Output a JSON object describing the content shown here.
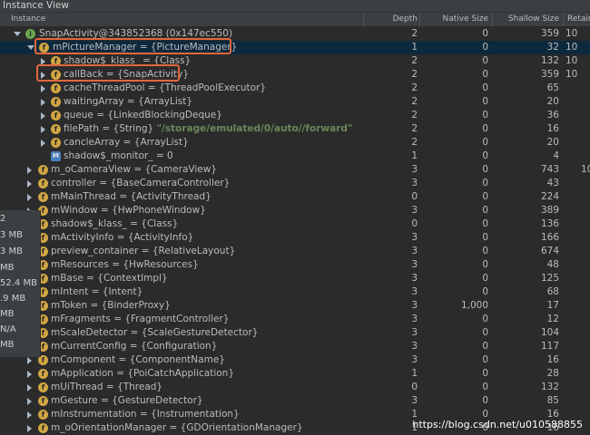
{
  "window": {
    "title": "Instance View"
  },
  "columns": {
    "instance": "Instance",
    "depth": "Depth",
    "native": "Native Size",
    "shallow": "Shallow Size",
    "retained": "Retaine"
  },
  "rows": [
    {
      "label": "SnapActivity@343852368 (0x147ec550)",
      "depth": "2",
      "native": "0",
      "shallow": "359",
      "retained": "10"
    },
    {
      "label": "mPictureManager = {PictureManager}",
      "depth": "1",
      "native": "0",
      "shallow": "32",
      "retained": "10"
    },
    {
      "label": "shadow$_klass_ = {Class}",
      "depth": "2",
      "native": "0",
      "shallow": "132",
      "retained": "10"
    },
    {
      "label": "callBack = {SnapActivity}",
      "depth": "2",
      "native": "0",
      "shallow": "359",
      "retained": "10"
    },
    {
      "label": "cacheThreadPool = {ThreadPoolExecutor}",
      "depth": "2",
      "native": "0",
      "shallow": "65",
      "retained": ""
    },
    {
      "label": "waitingArray = {ArrayList}",
      "depth": "2",
      "native": "0",
      "shallow": "20",
      "retained": ""
    },
    {
      "label": "queue = {LinkedBlockingDeque}",
      "depth": "2",
      "native": "0",
      "shallow": "36",
      "retained": ""
    },
    {
      "label": "filePath = {String} ",
      "str": "\"/storage/emulated/0/auto//forward\"",
      "depth": "2",
      "native": "0",
      "shallow": "16",
      "retained": ""
    },
    {
      "label": "cancleArray = {ArrayList}",
      "depth": "2",
      "native": "0",
      "shallow": "20",
      "retained": ""
    },
    {
      "label": "shadow$_monitor_ = 0",
      "depth": "1",
      "native": "0",
      "shallow": "4",
      "retained": ""
    },
    {
      "label": "m_oCameraView = {CameraView}",
      "depth": "3",
      "native": "0",
      "shallow": "743",
      "retained": "10"
    },
    {
      "label": "controller = {BaseCameraController}",
      "depth": "3",
      "native": "0",
      "shallow": "43",
      "retained": ""
    },
    {
      "label": "mMainThread = {ActivityThread}",
      "depth": "0",
      "native": "0",
      "shallow": "224",
      "retained": ""
    },
    {
      "label": "mWindow = {HwPhoneWindow}",
      "depth": "3",
      "native": "0",
      "shallow": "389",
      "retained": ""
    },
    {
      "label": "shadow$_klass_ = {Class}",
      "depth": "0",
      "native": "0",
      "shallow": "136",
      "retained": ""
    },
    {
      "label": "mActivityInfo = {ActivityInfo}",
      "depth": "3",
      "native": "0",
      "shallow": "166",
      "retained": ""
    },
    {
      "label": "preview_container = {RelativeLayout}",
      "depth": "3",
      "native": "0",
      "shallow": "674",
      "retained": ""
    },
    {
      "label": "mResources = {HwResources}",
      "depth": "3",
      "native": "0",
      "shallow": "48",
      "retained": ""
    },
    {
      "label": "mBase = {ContextImpl}",
      "depth": "3",
      "native": "0",
      "shallow": "125",
      "retained": ""
    },
    {
      "label": "mIntent = {Intent}",
      "depth": "3",
      "native": "0",
      "shallow": "68",
      "retained": ""
    },
    {
      "label": "mToken = {BinderProxy}",
      "depth": "3",
      "native": "1,000",
      "shallow": "17",
      "retained": ""
    },
    {
      "label": "mFragments = {FragmentController}",
      "depth": "3",
      "native": "0",
      "shallow": "12",
      "retained": ""
    },
    {
      "label": "mScaleDetector = {ScaleGestureDetector}",
      "depth": "3",
      "native": "0",
      "shallow": "104",
      "retained": ""
    },
    {
      "label": "mCurrentConfig = {Configuration}",
      "depth": "3",
      "native": "0",
      "shallow": "117",
      "retained": ""
    },
    {
      "label": "mComponent = {ComponentName}",
      "depth": "3",
      "native": "0",
      "shallow": "16",
      "retained": ""
    },
    {
      "label": "mApplication = {PoiCatchApplication}",
      "depth": "1",
      "native": "0",
      "shallow": "28",
      "retained": ""
    },
    {
      "label": "mUiThread = {Thread}",
      "depth": "0",
      "native": "0",
      "shallow": "132",
      "retained": ""
    },
    {
      "label": "mGesture = {GestureDetector}",
      "depth": "3",
      "native": "0",
      "shallow": "85",
      "retained": ""
    },
    {
      "label": "mInstrumentation = {Instrumentation}",
      "depth": "1",
      "native": "0",
      "shallow": "16",
      "retained": ""
    },
    {
      "label": "m_oOrientationManager = {GDOrientationManager}",
      "depth": "1",
      "native": "0",
      "shallow": "16",
      "retained": ""
    }
  ],
  "popup": {
    "items": [
      "2",
      "3 MB",
      "3 MB",
      "MB",
      "52.4 MB",
      ".9 MB",
      "MB",
      "N/A",
      "MB"
    ]
  },
  "watermark": "https://blog.csdn.net/u010588855"
}
